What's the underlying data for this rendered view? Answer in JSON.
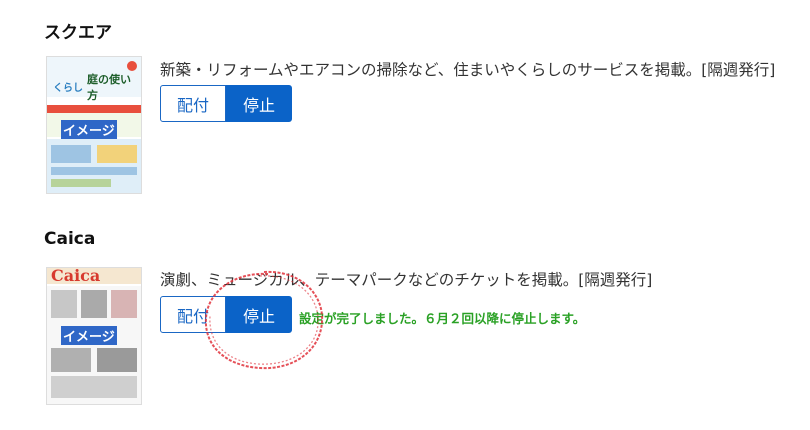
{
  "sections": [
    {
      "heading": "スクエア",
      "description": "新築・リフォームやエアコンの掃除など、住まいやくらしのサービスを掲載。[隔週発行]",
      "thumbnail_label": "イメージ",
      "buttons": {
        "deliver": "配付",
        "stop": "停止"
      }
    },
    {
      "heading": "Caica",
      "description": "演劇、ミュージカル、テーマパークなどのチケットを掲載。[隔週発行]",
      "thumbnail_label": "イメージ",
      "buttons": {
        "deliver": "配付",
        "stop": "停止"
      },
      "status_message": "設定が完了しました。６月２回以降に停止します。"
    }
  ],
  "thumb_text": {
    "square_title_a": "くらし",
    "square_title_b": "庭の使い方",
    "caica_logo": "Caica"
  },
  "colors": {
    "primary": "#0b63c8",
    "success": "#2aa125",
    "annotation": "#e0303a"
  }
}
